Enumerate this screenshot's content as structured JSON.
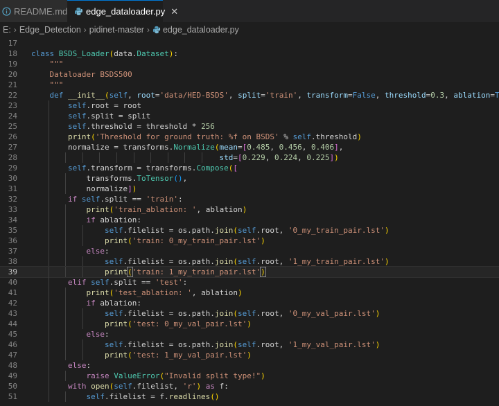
{
  "tabs": [
    {
      "label": "README.md",
      "icon": "info-icon",
      "active": false
    },
    {
      "label": "edge_dataloader.py",
      "icon": "python-file-icon",
      "active": true
    }
  ],
  "close_glyph": "✕",
  "breadcrumb": [
    "E:",
    "Edge_Detection",
    "pidinet-master",
    "edge_dataloader.py"
  ],
  "colors": {
    "python_icon": "#519aba",
    "info_icon": "#519aba",
    "active_tab_border": "#0078d4"
  },
  "current_line": 39,
  "code_lines": [
    {
      "n": 17,
      "t": []
    },
    {
      "n": 18,
      "t": [
        [
          "kw",
          "class "
        ],
        [
          "cls",
          "BSDS_Loader"
        ],
        [
          "br1",
          "("
        ],
        [
          "",
          "data."
        ],
        [
          "cls",
          "Dataset"
        ],
        [
          "br1",
          ")"
        ],
        [
          "",
          ":"
        ]
      ]
    },
    {
      "n": 19,
      "t": [
        [
          "",
          "    "
        ],
        [
          "str",
          "\"\"\""
        ]
      ]
    },
    {
      "n": 20,
      "t": [
        [
          "",
          "    "
        ],
        [
          "str",
          "Dataloader BSDS500"
        ]
      ]
    },
    {
      "n": 21,
      "t": [
        [
          "",
          "    "
        ],
        [
          "str",
          "\"\"\""
        ]
      ]
    },
    {
      "n": 22,
      "t": [
        [
          "",
          "    "
        ],
        [
          "kw",
          "def "
        ],
        [
          "fn",
          "__init__"
        ],
        [
          "br1",
          "("
        ],
        [
          "selfk",
          "self"
        ],
        [
          "",
          ", "
        ],
        [
          "param",
          "root"
        ],
        [
          "",
          "="
        ],
        [
          "str",
          "'data/HED-BSDS'"
        ],
        [
          "",
          ", "
        ],
        [
          "param",
          "split"
        ],
        [
          "",
          "="
        ],
        [
          "str",
          "'train'"
        ],
        [
          "",
          ", "
        ],
        [
          "param",
          "transform"
        ],
        [
          "",
          "="
        ],
        [
          "kw",
          "False"
        ],
        [
          "",
          ", "
        ],
        [
          "param",
          "threshold"
        ],
        [
          "",
          "="
        ],
        [
          "num",
          "0.3"
        ],
        [
          "",
          ", "
        ],
        [
          "param",
          "ablation"
        ],
        [
          "",
          "="
        ],
        [
          "kw",
          "True"
        ],
        [
          "br1",
          ")"
        ],
        [
          "",
          ":"
        ]
      ]
    },
    {
      "n": 23,
      "t": [
        [
          "",
          "        "
        ],
        [
          "selfk",
          "self"
        ],
        [
          "",
          ".root = root"
        ]
      ]
    },
    {
      "n": 24,
      "t": [
        [
          "",
          "        "
        ],
        [
          "selfk",
          "self"
        ],
        [
          "",
          ".split = split"
        ]
      ]
    },
    {
      "n": 25,
      "t": [
        [
          "",
          "        "
        ],
        [
          "selfk",
          "self"
        ],
        [
          "",
          ".threshold = threshold * "
        ],
        [
          "num",
          "256"
        ]
      ]
    },
    {
      "n": 26,
      "t": [
        [
          "",
          "        "
        ],
        [
          "fn",
          "print"
        ],
        [
          "br1",
          "("
        ],
        [
          "str",
          "'Threshold for ground truth: %f on BSDS'"
        ],
        [
          "",
          " % "
        ],
        [
          "selfk",
          "self"
        ],
        [
          "",
          ".threshold"
        ],
        [
          "br1",
          ")"
        ]
      ]
    },
    {
      "n": 27,
      "t": [
        [
          "",
          "        normalize = transforms."
        ],
        [
          "cls",
          "Normalize"
        ],
        [
          "br1",
          "("
        ],
        [
          "param",
          "mean"
        ],
        [
          "",
          "="
        ],
        [
          "br2",
          "["
        ],
        [
          "num",
          "0.485"
        ],
        [
          "",
          ", "
        ],
        [
          "num",
          "0.456"
        ],
        [
          "",
          ", "
        ],
        [
          "num",
          "0.406"
        ],
        [
          "br2",
          "]"
        ],
        [
          "",
          ","
        ]
      ]
    },
    {
      "n": 28,
      "t": [
        [
          "",
          "                                         "
        ],
        [
          "param",
          "std"
        ],
        [
          "",
          "="
        ],
        [
          "br2",
          "["
        ],
        [
          "num",
          "0.229"
        ],
        [
          "",
          ", "
        ],
        [
          "num",
          "0.224"
        ],
        [
          "",
          ", "
        ],
        [
          "num",
          "0.225"
        ],
        [
          "br2",
          "]"
        ],
        [
          "br1",
          ")"
        ]
      ]
    },
    {
      "n": 29,
      "t": [
        [
          "",
          "        "
        ],
        [
          "selfk",
          "self"
        ],
        [
          "",
          ".transform = transforms."
        ],
        [
          "cls",
          "Compose"
        ],
        [
          "br1",
          "("
        ],
        [
          "br2",
          "["
        ]
      ]
    },
    {
      "n": 30,
      "t": [
        [
          "",
          "            transforms."
        ],
        [
          "cls",
          "ToTensor"
        ],
        [
          "br3",
          "()"
        ],
        [
          "",
          ","
        ]
      ]
    },
    {
      "n": 31,
      "t": [
        [
          "",
          "            normalize"
        ],
        [
          "br2",
          "]"
        ],
        [
          "br1",
          ")"
        ]
      ]
    },
    {
      "n": 32,
      "t": [
        [
          "",
          "        "
        ],
        [
          "ctrl",
          "if "
        ],
        [
          "selfk",
          "self"
        ],
        [
          "",
          ".split == "
        ],
        [
          "str",
          "'train'"
        ],
        [
          "",
          ":"
        ]
      ]
    },
    {
      "n": 33,
      "t": [
        [
          "",
          "            "
        ],
        [
          "fn",
          "print"
        ],
        [
          "br1",
          "("
        ],
        [
          "str",
          "'train_ablation: '"
        ],
        [
          "",
          ", ablation"
        ],
        [
          "br1",
          ")"
        ]
      ]
    },
    {
      "n": 34,
      "t": [
        [
          "",
          "            "
        ],
        [
          "ctrl",
          "if "
        ],
        [
          "",
          "ablation:"
        ]
      ]
    },
    {
      "n": 35,
      "t": [
        [
          "",
          "                "
        ],
        [
          "selfk",
          "self"
        ],
        [
          "",
          ".filelist = os.path."
        ],
        [
          "fn",
          "join"
        ],
        [
          "br1",
          "("
        ],
        [
          "selfk",
          "self"
        ],
        [
          "",
          ".root, "
        ],
        [
          "str",
          "'0_my_train_pair.lst'"
        ],
        [
          "br1",
          ")"
        ]
      ]
    },
    {
      "n": 36,
      "t": [
        [
          "",
          "                "
        ],
        [
          "fn",
          "print"
        ],
        [
          "br1",
          "("
        ],
        [
          "str",
          "'train: 0_my_train_pair.lst'"
        ],
        [
          "br1",
          ")"
        ]
      ]
    },
    {
      "n": 37,
      "t": [
        [
          "",
          "            "
        ],
        [
          "ctrl",
          "else"
        ],
        [
          "",
          ":"
        ]
      ]
    },
    {
      "n": 38,
      "t": [
        [
          "",
          "                "
        ],
        [
          "selfk",
          "self"
        ],
        [
          "",
          ".filelist = os.path."
        ],
        [
          "fn",
          "join"
        ],
        [
          "br1",
          "("
        ],
        [
          "selfk",
          "self"
        ],
        [
          "",
          ".root, "
        ],
        [
          "str",
          "'1_my_train_pair.lst'"
        ],
        [
          "br1",
          ")"
        ]
      ]
    },
    {
      "n": 39,
      "t": [
        [
          "",
          "                "
        ],
        [
          "fn",
          "print"
        ],
        [
          "br1hl",
          "("
        ],
        [
          "str",
          "'train: 1_my_train_pair.lst'"
        ],
        [
          "br1hl",
          ")"
        ]
      ]
    },
    {
      "n": 40,
      "t": [
        [
          "",
          "        "
        ],
        [
          "ctrl",
          "elif "
        ],
        [
          "selfk",
          "self"
        ],
        [
          "",
          ".split == "
        ],
        [
          "str",
          "'test'"
        ],
        [
          "",
          ":"
        ]
      ]
    },
    {
      "n": 41,
      "t": [
        [
          "",
          "            "
        ],
        [
          "fn",
          "print"
        ],
        [
          "br1",
          "("
        ],
        [
          "str",
          "'test_ablation: '"
        ],
        [
          "",
          ", ablation"
        ],
        [
          "br1",
          ")"
        ]
      ]
    },
    {
      "n": 42,
      "t": [
        [
          "",
          "            "
        ],
        [
          "ctrl",
          "if "
        ],
        [
          "",
          "ablation:"
        ]
      ]
    },
    {
      "n": 43,
      "t": [
        [
          "",
          "                "
        ],
        [
          "selfk",
          "self"
        ],
        [
          "",
          ".filelist = os.path."
        ],
        [
          "fn",
          "join"
        ],
        [
          "br1",
          "("
        ],
        [
          "selfk",
          "self"
        ],
        [
          "",
          ".root, "
        ],
        [
          "str",
          "'0_my_val_pair.lst'"
        ],
        [
          "br1",
          ")"
        ]
      ]
    },
    {
      "n": 44,
      "t": [
        [
          "",
          "                "
        ],
        [
          "fn",
          "print"
        ],
        [
          "br1",
          "("
        ],
        [
          "str",
          "'test: 0_my_val_pair.lst'"
        ],
        [
          "br1",
          ")"
        ]
      ]
    },
    {
      "n": 45,
      "t": [
        [
          "",
          "            "
        ],
        [
          "ctrl",
          "else"
        ],
        [
          "",
          ":"
        ]
      ]
    },
    {
      "n": 46,
      "t": [
        [
          "",
          "                "
        ],
        [
          "selfk",
          "self"
        ],
        [
          "",
          ".filelist = os.path."
        ],
        [
          "fn",
          "join"
        ],
        [
          "br1",
          "("
        ],
        [
          "selfk",
          "self"
        ],
        [
          "",
          ".root, "
        ],
        [
          "str",
          "'1_my_val_pair.lst'"
        ],
        [
          "br1",
          ")"
        ]
      ]
    },
    {
      "n": 47,
      "t": [
        [
          "",
          "                "
        ],
        [
          "fn",
          "print"
        ],
        [
          "br1",
          "("
        ],
        [
          "str",
          "'test: 1_my_val_pair.lst'"
        ],
        [
          "br1",
          ")"
        ]
      ]
    },
    {
      "n": 48,
      "t": [
        [
          "",
          "        "
        ],
        [
          "ctrl",
          "else"
        ],
        [
          "",
          ":"
        ]
      ]
    },
    {
      "n": 49,
      "t": [
        [
          "",
          "            "
        ],
        [
          "ctrl",
          "raise "
        ],
        [
          "cls",
          "ValueError"
        ],
        [
          "br1",
          "("
        ],
        [
          "str",
          "\"Invalid split type!\""
        ],
        [
          "br1",
          ")"
        ]
      ]
    },
    {
      "n": 50,
      "t": [
        [
          "",
          "        "
        ],
        [
          "ctrl",
          "with "
        ],
        [
          "fn",
          "open"
        ],
        [
          "br1",
          "("
        ],
        [
          "selfk",
          "self"
        ],
        [
          "",
          ".filelist, "
        ],
        [
          "str",
          "'r'"
        ],
        [
          "br1",
          ")"
        ],
        [
          "ctrl",
          " as "
        ],
        [
          "",
          "f:"
        ]
      ]
    },
    {
      "n": 51,
      "t": [
        [
          "",
          "            "
        ],
        [
          "selfk",
          "self"
        ],
        [
          "",
          ".filelist = f."
        ],
        [
          "fn",
          "readlines"
        ],
        [
          "br1",
          "()"
        ]
      ]
    }
  ]
}
